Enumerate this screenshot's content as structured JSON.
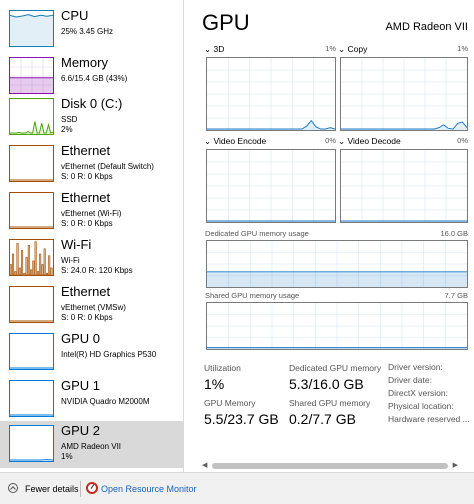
{
  "colors": {
    "cpu": "#117dbb",
    "memory": "#8b12ae",
    "disk": "#4da60c",
    "ethernet": "#a74f01",
    "gpu": "#0078d7",
    "selected_bg": "#d9d9d9",
    "link": "#1565c0"
  },
  "sidebar": {
    "items": [
      {
        "title": "CPU",
        "line1": "25%  3.45 GHz",
        "line2": "",
        "kind": "cpu",
        "values": [
          0.9,
          0.85,
          0.88,
          0.92,
          0.86,
          0.9,
          0.87,
          0.9
        ]
      },
      {
        "title": "Memory",
        "line1": "6.6/15.4 GB (43%)",
        "line2": "",
        "kind": "memory",
        "values": [
          0.43,
          0.43,
          0.43,
          0.43,
          0.43,
          0.43,
          0.43,
          0.43
        ]
      },
      {
        "title": "Disk 0 (C:)",
        "line1": "SSD",
        "line2": "2%",
        "kind": "disk",
        "values": [
          0,
          0,
          0,
          0,
          0.02,
          0,
          0,
          0,
          0.05,
          0,
          0,
          0.35,
          0,
          0,
          0.3,
          0,
          0,
          0.25,
          0,
          0.02
        ]
      },
      {
        "title": "Ethernet",
        "line1": "vEthernet (Default Switch)",
        "line2": "S: 0  R: 0 Kbps",
        "kind": "ethernet",
        "values": [
          0,
          0,
          0,
          0,
          0,
          0,
          0,
          0
        ]
      },
      {
        "title": "Ethernet",
        "line1": "vEthernet (Wi-Fi)",
        "line2": "S: 0  R: 0 Kbps",
        "kind": "ethernet",
        "values": [
          0,
          0,
          0,
          0,
          0,
          0,
          0,
          0
        ]
      },
      {
        "title": "Wi-Fi",
        "line1": "Wi-Fi",
        "line2": "S: 24.0  R: 120 Kbps",
        "kind": "wifi",
        "values": [
          0.3,
          0.6,
          0.1,
          0.9,
          0.2,
          0.7,
          0.05,
          0.5,
          0.85,
          0.15,
          0.4,
          0.95,
          0.1,
          0.6,
          0.3,
          0.75,
          0.05,
          0.55,
          0.2
        ]
      },
      {
        "title": "Ethernet",
        "line1": "vEthernet (VMSw)",
        "line2": "S: 0  R: 0 Kbps",
        "kind": "ethernet",
        "values": [
          0,
          0,
          0,
          0,
          0,
          0,
          0,
          0
        ]
      },
      {
        "title": "GPU 0",
        "line1": "Intel(R) HD Graphics P530",
        "line2": "",
        "kind": "gpu",
        "values": [
          0,
          0,
          0,
          0,
          0,
          0,
          0,
          0
        ]
      },
      {
        "title": "GPU 1",
        "line1": "NVIDIA Quadro M2000M",
        "line2": "",
        "kind": "gpu",
        "values": [
          0,
          0,
          0,
          0,
          0,
          0,
          0,
          0
        ]
      },
      {
        "title": "GPU 2",
        "line1": "AMD Radeon VII",
        "line2": "1%",
        "kind": "gpu",
        "values": [
          0,
          0,
          0,
          0,
          0,
          0,
          0.01,
          0
        ],
        "selected": true
      }
    ]
  },
  "main": {
    "title": "GPU",
    "gpu_name": "AMD Radeon VII",
    "engines": [
      {
        "name": "3D",
        "percent": "1%",
        "values": [
          0,
          0,
          0,
          0,
          0,
          0,
          0,
          0,
          0,
          0,
          0,
          0,
          0,
          0,
          0,
          0,
          0,
          0,
          0,
          0,
          0,
          0.04,
          0.12,
          0.03,
          0,
          0,
          0.02,
          0
        ]
      },
      {
        "name": "Copy",
        "percent": "1%",
        "values": [
          0,
          0,
          0,
          0,
          0,
          0,
          0,
          0,
          0,
          0,
          0,
          0,
          0,
          0,
          0,
          0,
          0,
          0,
          0,
          0,
          0,
          0.02,
          0.06,
          0.01,
          0,
          0.08,
          0.1,
          0.02
        ]
      },
      {
        "name": "Video Encode",
        "percent": "0%",
        "values": [
          0,
          0,
          0,
          0,
          0,
          0,
          0,
          0
        ]
      },
      {
        "name": "Video Decode",
        "percent": "0%",
        "values": [
          0,
          0,
          0,
          0,
          0,
          0,
          0,
          0
        ]
      }
    ],
    "dedicated": {
      "label": "Dedicated GPU memory usage",
      "max": "16.0 GB",
      "fraction": 0.33
    },
    "shared": {
      "label": "Shared GPU memory usage",
      "max": "7.7 GB",
      "fraction": 0.03
    },
    "stats": {
      "utilization_label": "Utilization",
      "utilization_value": "1%",
      "dedicated_label": "Dedicated GPU memory",
      "dedicated_value": "5.3/16.0 GB",
      "gpu_memory_label": "GPU Memory",
      "gpu_memory_value": "5.5/23.7 GB",
      "shared_label": "Shared GPU memory",
      "shared_value": "0.2/7.7 GB"
    },
    "properties": [
      "Driver version:",
      "Driver date:",
      "DirectX version:",
      "Physical location:",
      "Hardware reserved ..."
    ]
  },
  "footer": {
    "fewer_details": "Fewer details",
    "resource_monitor": "Open Resource Monitor"
  }
}
